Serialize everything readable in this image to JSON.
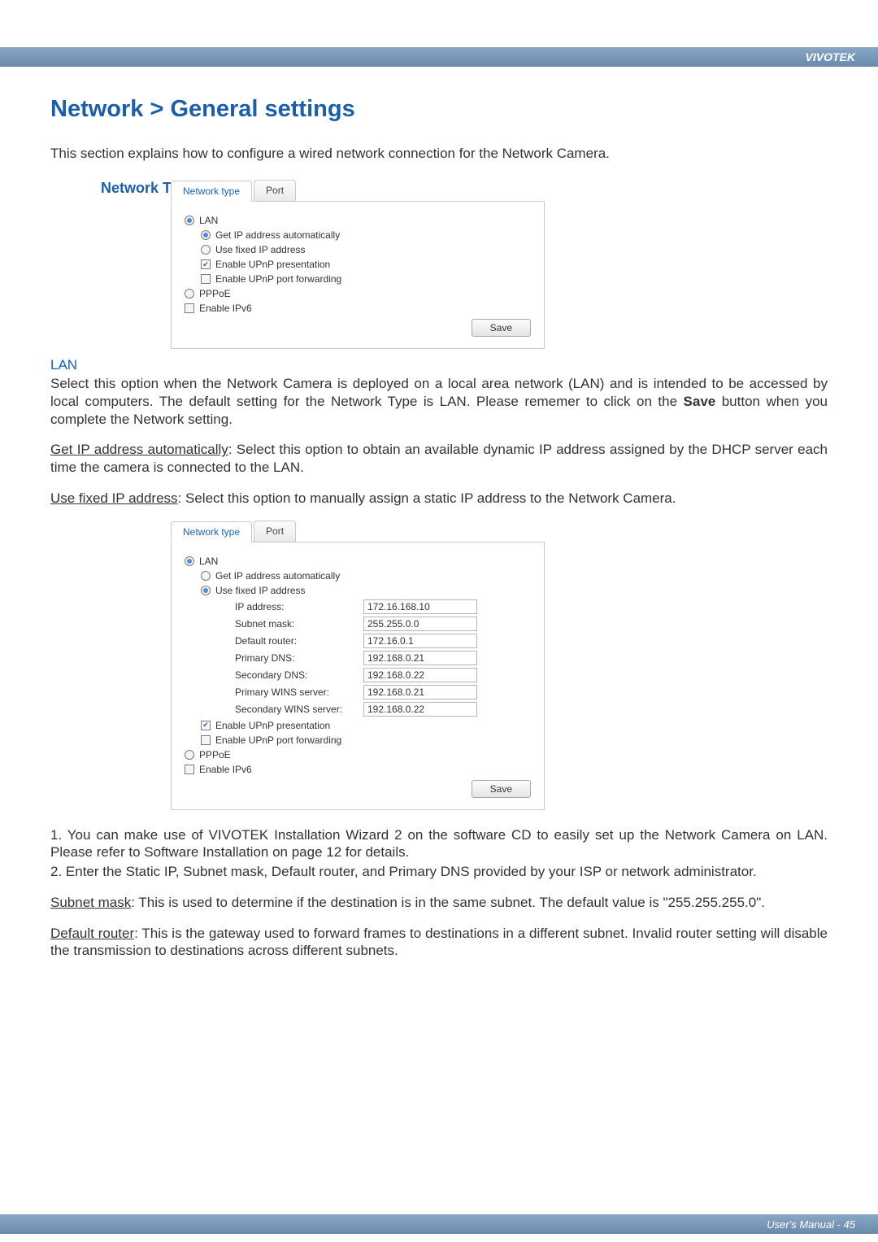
{
  "brand": "VIVOTEK",
  "page_heading": "Network > General settings",
  "intro": "This section explains how to configure a wired network connection for the Network Camera.",
  "network_type_label": "Network Type",
  "tabs": {
    "network_type": "Network type",
    "port": "Port"
  },
  "shot1": {
    "lan": "LAN",
    "get_ip": "Get IP address automatically",
    "use_fixed": "Use fixed IP address",
    "upnp_presentation": "Enable UPnP presentation",
    "upnp_port": "Enable UPnP port forwarding",
    "pppoe": "PPPoE",
    "enable_ipv6": "Enable IPv6",
    "save": "Save"
  },
  "lan_heading": "LAN",
  "lan_paragraph": "Select this option when the Network Camera is deployed on a local area network (LAN) and is intended to be accessed by local computers. The default setting for the Network Type is LAN. Please rememer to click on the Save button when you complete the Network setting.",
  "getip_paragraph_label": "Get IP address automatically",
  "getip_paragraph_rest": ": Select this option to obtain an available dynamic IP address assigned by the DHCP server each time the camera is connected to the LAN.",
  "usefixed_paragraph_label": "Use fixed IP address",
  "usefixed_paragraph_rest": ": Select this option to manually assign a static IP address to the Network Camera.",
  "shot2": {
    "ip_address_lbl": "IP address:",
    "ip_address_val": "172.16.168.10",
    "subnet_lbl": "Subnet mask:",
    "subnet_val": "255.255.0.0",
    "router_lbl": "Default router:",
    "router_val": "172.16.0.1",
    "pdns_lbl": "Primary DNS:",
    "pdns_val": "192.168.0.21",
    "sdns_lbl": "Secondary DNS:",
    "sdns_val": "192.168.0.22",
    "pwins_lbl": "Primary WINS server:",
    "pwins_val": "192.168.0.21",
    "swins_lbl": "Secondary WINS server:",
    "swins_val": "192.168.0.22"
  },
  "list_item_1": "1. You can make use of VIVOTEK Installation Wizard 2 on the software CD to easily set up the Network Camera on LAN. Please refer to Software Installation on page 12 for details.",
  "list_item_2": "2. Enter the Static IP, Subnet mask, Default router, and Primary DNS provided by your ISP or network administrator.",
  "subnet_label": "Subnet mask",
  "subnet_rest": ": This is used to determine if the destination is in the same subnet. The default value is \"255.255.255.0\".",
  "router_label": "Default router",
  "router_rest": ": This is the gateway used to forward frames to destinations in a different subnet. Invalid router setting will disable the transmission to destinations across different subnets.",
  "footer": "User's Manual - 45"
}
